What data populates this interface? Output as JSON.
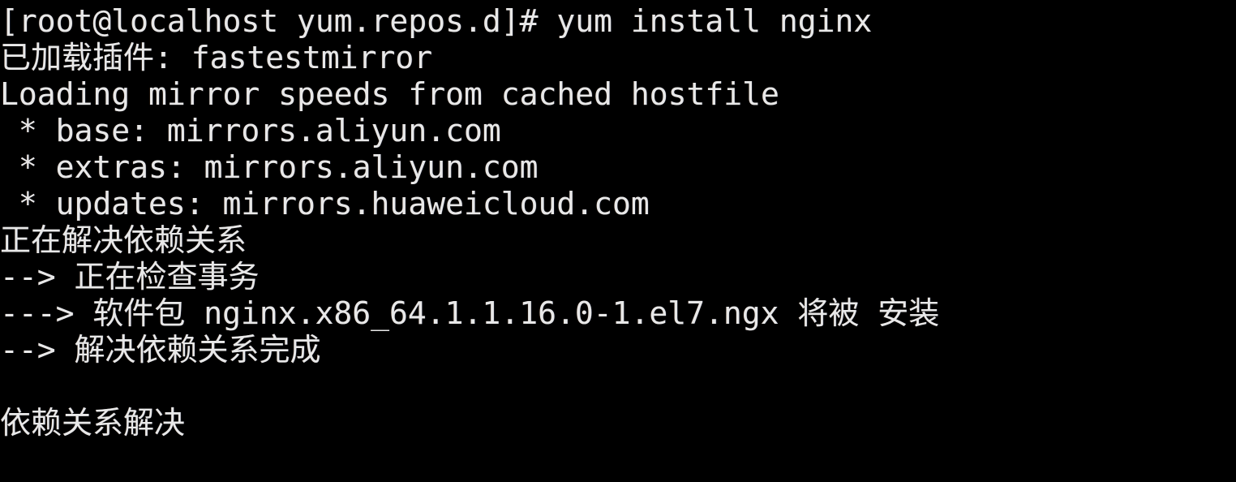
{
  "terminal": {
    "app": "linux-terminal",
    "background_color": "#000000",
    "foreground_color": "#e8e8e8",
    "prompt": {
      "user": "root",
      "host": "localhost",
      "cwd": "yum.repos.d",
      "symbol": "#",
      "full": "[root@localhost yum.repos.d]#"
    },
    "command": "yum install nginx",
    "lines": [
      {
        "id": "prompt-command",
        "text": "[root@localhost yum.repos.d]# yum install nginx",
        "kind": "command"
      },
      {
        "id": "plugins-loaded",
        "text": "已加载插件: fastestmirror",
        "kind": "output"
      },
      {
        "id": "loading-mirror-speeds",
        "text": "Loading mirror speeds from cached hostfile",
        "kind": "output"
      },
      {
        "id": "repo-base",
        "text": " * base: mirrors.aliyun.com",
        "kind": "output"
      },
      {
        "id": "repo-extras",
        "text": " * extras: mirrors.aliyun.com",
        "kind": "output"
      },
      {
        "id": "repo-updates",
        "text": " * updates: mirrors.huaweicloud.com",
        "kind": "output"
      },
      {
        "id": "resolving-dependencies",
        "text": "正在解决依赖关系",
        "kind": "output"
      },
      {
        "id": "checking-transaction",
        "text": "--> 正在检查事务",
        "kind": "output"
      },
      {
        "id": "package-to-install",
        "text": "---> 软件包 nginx.x86_64.1.1.16.0-1.el7.ngx 将被 安装",
        "kind": "output"
      },
      {
        "id": "dependency-resolution-finished",
        "text": "--> 解决依赖关系完成",
        "kind": "output"
      },
      {
        "id": "blank-separator",
        "text": "",
        "kind": "blank"
      },
      {
        "id": "dependencies-resolved",
        "text": "依赖关系解决",
        "kind": "output"
      }
    ],
    "repositories": [
      {
        "name": "base",
        "mirror": "mirrors.aliyun.com"
      },
      {
        "name": "extras",
        "mirror": "mirrors.aliyun.com"
      },
      {
        "name": "updates",
        "mirror": "mirrors.huaweicloud.com"
      }
    ],
    "package": {
      "name": "nginx",
      "arch": "x86_64",
      "epoch": "1",
      "version": "1.16.0",
      "release": "1.el7.ngx",
      "nevra": "nginx.x86_64.1.1.16.0-1.el7.ngx",
      "action": "将被 安装"
    },
    "plugin": "fastestmirror"
  }
}
